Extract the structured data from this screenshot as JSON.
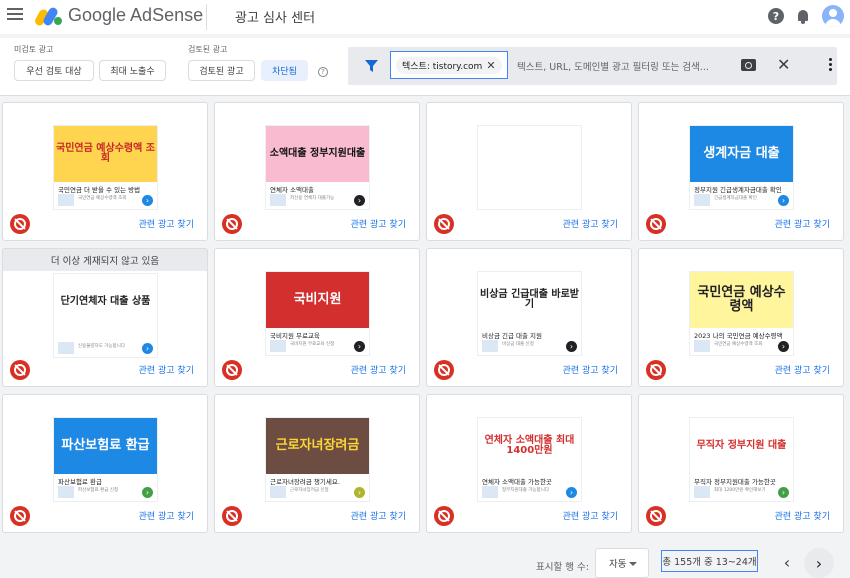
{
  "header": {
    "app_name": "Google AdSense",
    "page_title": "광고 심사 센터"
  },
  "filters": {
    "unreviewed_label": "미검토 광고",
    "reviewed_label": "검토된 광고",
    "chips": {
      "priority": "우선 검토 대상",
      "max_impressions": "최대 노출수",
      "reviewed": "검토된 광고",
      "blocked": "차단됨"
    },
    "search": {
      "active_filter": "텍스트: tistory.com",
      "placeholder": "텍스트, URL, 도메인별 광고 필터링 또는 검색..."
    }
  },
  "cards": [
    {
      "banner": "",
      "ad_headline": "국민연금 더 받을 수 있는 방법",
      "ad_image_text": "국민연금 예상수령액 조회",
      "ad_desc": "국민연금 예상수령액 조회",
      "link": "관련 광고 찾기",
      "img_bg": "#ffd54f",
      "img_color": "#c62828",
      "btn_color": "#1e88e5"
    },
    {
      "banner": "",
      "ad_headline": "연체자 소액대출",
      "ad_image_text": "소액대출 정부지원대출",
      "ad_desc": "저신용 연체자 대출가능",
      "link": "관련 광고 찾기",
      "img_bg": "#f8bbd0",
      "img_color": "#111111",
      "btn_color": "#202124"
    },
    {
      "banner": "",
      "ad_headline": "",
      "ad_image_text": "",
      "ad_desc": "",
      "link": "관련 광고 찾기",
      "img_bg": "#ffffff",
      "img_color": "#1a73e8",
      "btn_color": "#ffffff"
    },
    {
      "banner": "",
      "ad_headline": "정부지원 긴급생계자금대출 확인",
      "ad_image_text": "생계자금 대출",
      "ad_desc": "긴급생계자금대출 확인",
      "link": "관련 광고 찾기",
      "img_bg": "#1e88e5",
      "img_color": "#ffffff",
      "btn_color": "#1e88e5"
    },
    {
      "banner": "더 이상 게재되지 않고 있음",
      "ad_headline": "",
      "ad_image_text": "단기연체자 대출 상품",
      "ad_desc": "신용불량자도 가능합니다",
      "link": "관련 광고 찾기",
      "img_bg": "#ffffff",
      "img_color": "#202124",
      "btn_color": "#1e88e5"
    },
    {
      "banner": "",
      "ad_headline": "국비지원 무료교육",
      "ad_image_text": "국비지원",
      "ad_desc": "국비지원 무료교육 신청",
      "link": "관련 광고 찾기",
      "img_bg": "#d32f2f",
      "img_color": "#ffffff",
      "btn_color": "#202124"
    },
    {
      "banner": "",
      "ad_headline": "비상금 긴급 대출 지원",
      "ad_image_text": "비상금 긴급대출 바로받기",
      "ad_desc": "비상금 대출 신청",
      "link": "관련 광고 찾기",
      "img_bg": "#ffffff",
      "img_color": "#202124",
      "btn_color": "#202124"
    },
    {
      "banner": "",
      "ad_headline": "2023 나의 국민연금 예상수령액",
      "ad_image_text": "국민연금 예상수령액",
      "ad_desc": "국민연금 예상수령액 조회",
      "link": "관련 광고 찾기",
      "img_bg": "#fff59d",
      "img_color": "#202124",
      "btn_color": "#202124"
    },
    {
      "banner": "",
      "ad_headline": "파산보험료 환급",
      "ad_image_text": "파산보험료 환급",
      "ad_desc": "파산보험료 환급 신청",
      "link": "관련 광고 찾기",
      "img_bg": "#1e88e5",
      "img_color": "#ffffff",
      "btn_color": "#43a047"
    },
    {
      "banner": "",
      "ad_headline": "근로자녀장려금 챙기세요.",
      "ad_image_text": "근로자녀장려금",
      "ad_desc": "근로자녀장려금 신청",
      "link": "관련 광고 찾기",
      "img_bg": "#6d4c41",
      "img_color": "#fdd835",
      "btn_color": "#afb42b"
    },
    {
      "banner": "",
      "ad_headline": "연체자 소액대출 가능한곳",
      "ad_image_text": "연체자 소액대출 최대 1400만원",
      "ad_desc": "정부지원대출 가능합니다",
      "link": "관련 광고 찾기",
      "img_bg": "#ffffff",
      "img_color": "#d32f2f",
      "btn_color": "#1e88e5"
    },
    {
      "banner": "",
      "ad_headline": "무직자 정부지원대출 가능한곳",
      "ad_image_text": "무직자 정부지원 대출",
      "ad_desc": "최대 1200만원 확인해보기",
      "link": "관련 광고 찾기",
      "img_bg": "#ffffff",
      "img_color": "#d32f2f",
      "btn_color": "#43a047"
    }
  ],
  "pagination": {
    "rows_label": "표시할 행 수:",
    "rows_value": "자동",
    "page_info": "총 155개 중 13~24개"
  }
}
